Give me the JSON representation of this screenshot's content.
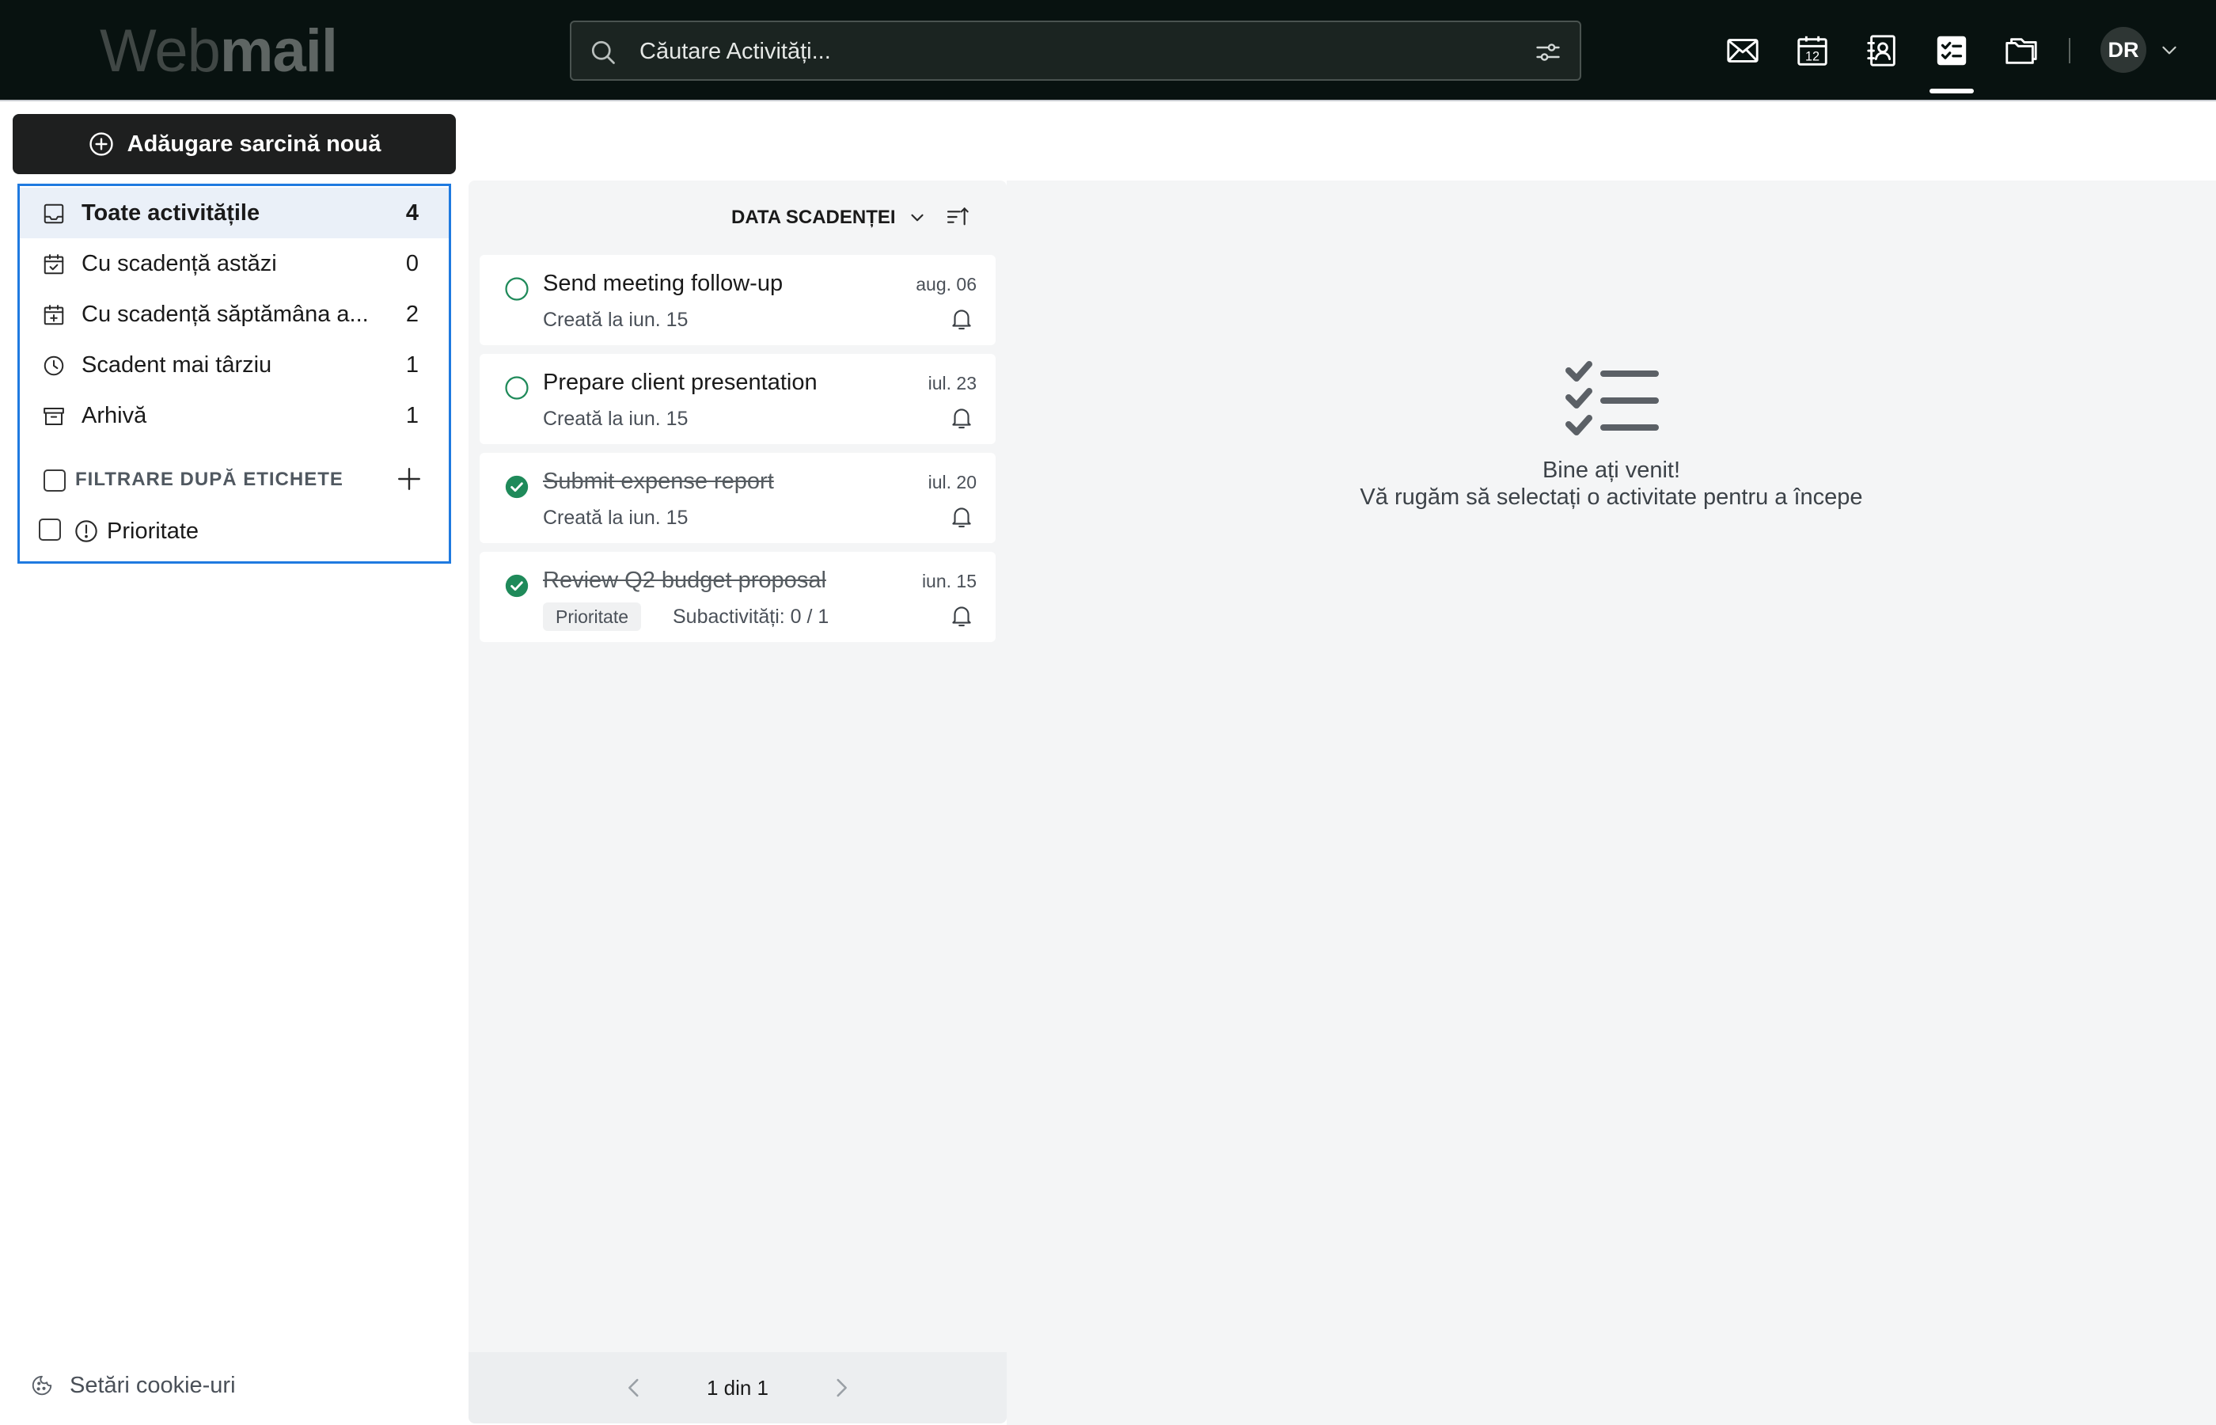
{
  "header": {
    "logo_part1": "Web",
    "logo_part2": "mail",
    "search_placeholder": "Căutare Activități...",
    "nav_icons": [
      "mail-icon",
      "calendar-icon",
      "contacts-icon",
      "tasks-icon",
      "files-icon"
    ],
    "calendar_day": "12",
    "active_nav": "tasks-icon",
    "user_initials": "DR"
  },
  "sidebar": {
    "new_task_label": "Adăugare sarcină nouă",
    "folders": [
      {
        "label": "Toate activitățile",
        "count": "4",
        "icon": "inbox-icon",
        "active": true
      },
      {
        "label": "Cu scadență astăzi",
        "count": "0",
        "icon": "calendar-check-icon",
        "active": false
      },
      {
        "label": "Cu scadență săptămâna a...",
        "count": "2",
        "icon": "calendar-plus-icon",
        "active": false
      },
      {
        "label": "Scadent mai târziu",
        "count": "1",
        "icon": "clock-icon",
        "active": false
      },
      {
        "label": "Arhivă",
        "count": "1",
        "icon": "archive-icon",
        "active": false
      }
    ],
    "tags_title": "FILTRARE DUPĂ ETICHETE",
    "tags": [
      {
        "label": "Prioritate",
        "icon": "exclamation-circle-icon"
      }
    ],
    "cookie_label": "Setări cookie-uri"
  },
  "task_list": {
    "sort_label": "DATA SCADENȚEI",
    "tasks": [
      {
        "title": "Send meeting follow-up",
        "due": "aug. 06",
        "meta": "Creată la iun. 15",
        "done": false
      },
      {
        "title": "Prepare client presentation",
        "due": "iul. 23",
        "meta": "Creată la iun. 15",
        "done": false
      },
      {
        "title": "Submit expense report",
        "due": "iul. 20",
        "meta": "Creată la iun. 15",
        "done": true
      },
      {
        "title": "Review Q2 budget proposal",
        "due": "iun. 15",
        "tag": "Prioritate",
        "subtasks": "Subactivități: 0 / 1",
        "done": true
      }
    ],
    "pagination": "1 din 1"
  },
  "detail": {
    "welcome_title": "Bine ați venit!",
    "welcome_subtitle": "Vă rugăm să selectați o activitate pentru a începe"
  },
  "colors": {
    "header_bg": "#081210",
    "accent_green": "#1f8a5a",
    "selection_border": "#1f7ae0",
    "primary_button": "#1e1f1f"
  }
}
